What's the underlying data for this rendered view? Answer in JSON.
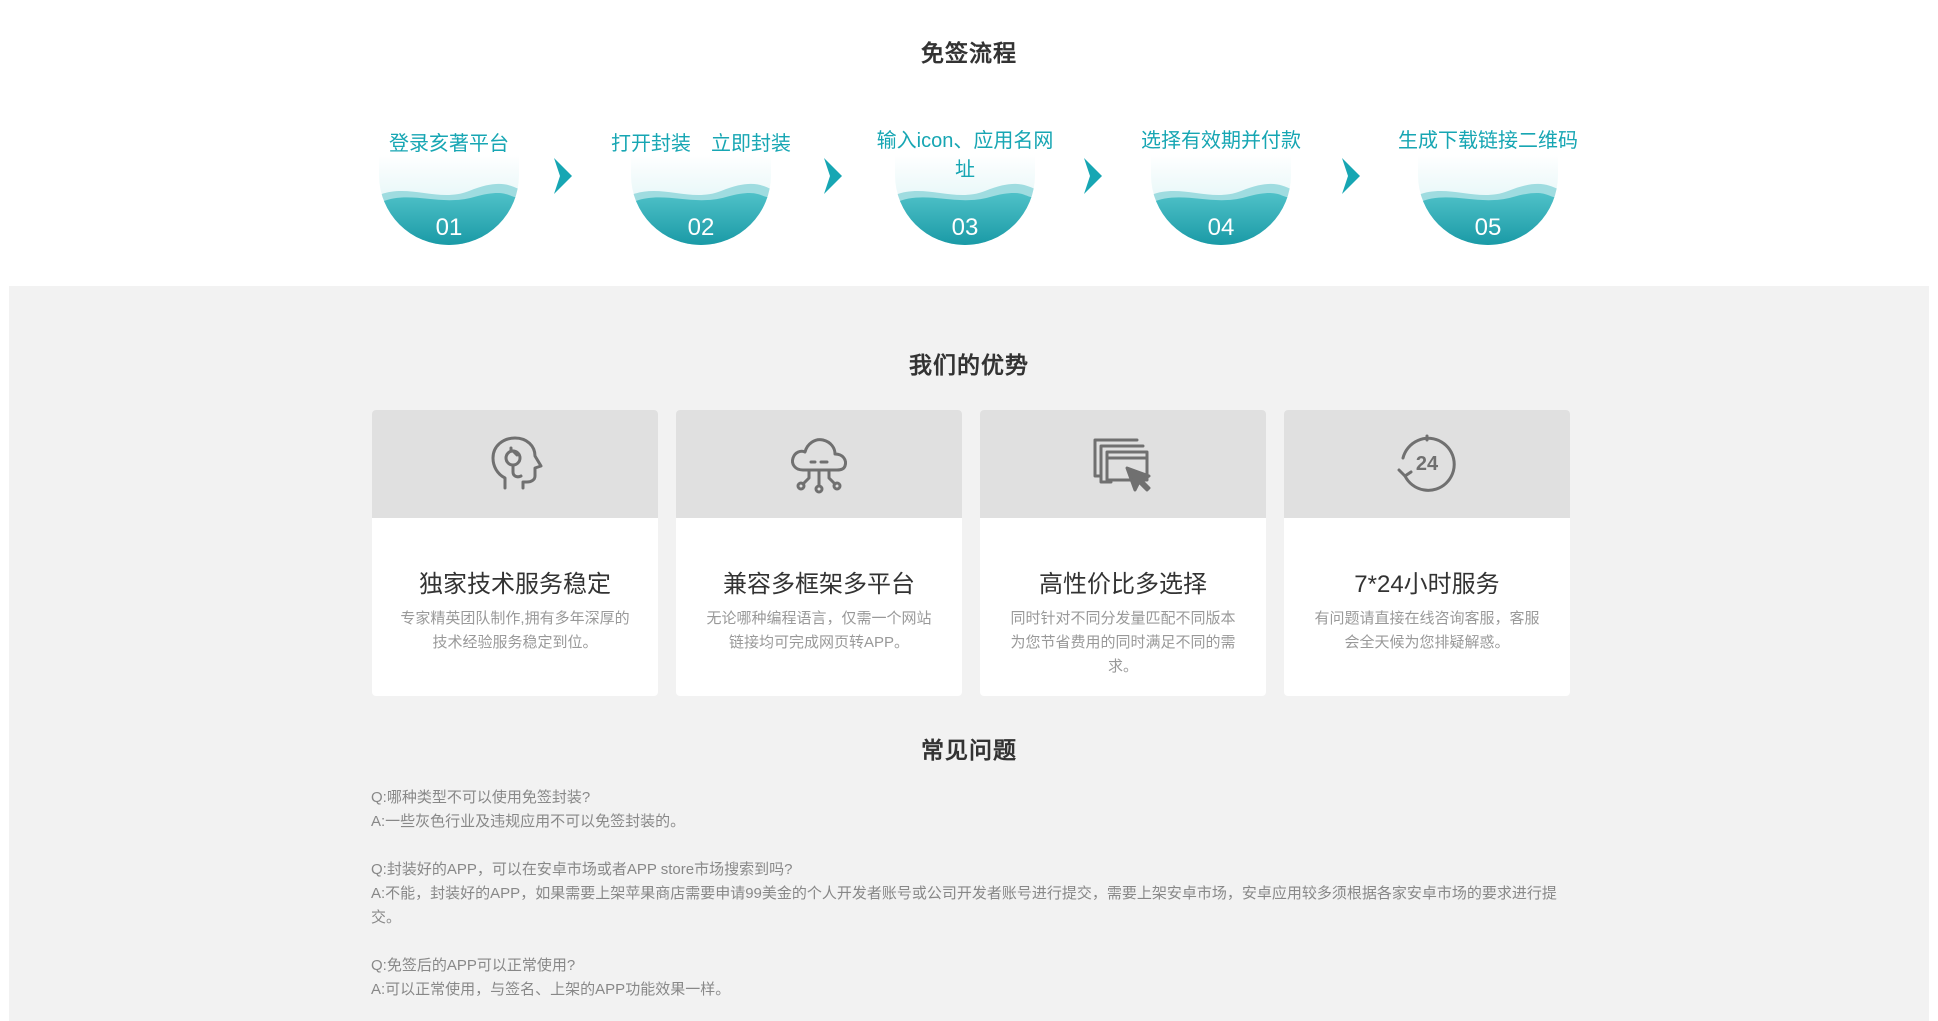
{
  "process": {
    "title": "免签流程",
    "steps": [
      {
        "label": "登录亥著平台",
        "num": "01"
      },
      {
        "label": "打开封装　立即封装",
        "num": "02"
      },
      {
        "label": "输入icon、应用名网址",
        "num": "03"
      },
      {
        "label": "选择有效期并付款",
        "num": "04"
      },
      {
        "label": "生成下载链接二维码",
        "num": "05"
      }
    ],
    "accent": "#17a6b3"
  },
  "advantages": {
    "title": "我们的优势",
    "cards": [
      {
        "icon": "tech-head-icon",
        "title": "独家技术服务稳定",
        "desc": "专家精英团队制作,拥有多年深厚的技术经验服务稳定到位。"
      },
      {
        "icon": "cloud-network-icon",
        "title": "兼容多框架多平台",
        "desc": "无论哪种编程语言，仅需一个网站链接均可完成网页转APP。"
      },
      {
        "icon": "window-cursor-icon",
        "title": "高性价比多选择",
        "desc": "同时针对不同分发量匹配不同版本为您节省费用的同时满足不同的需求。"
      },
      {
        "icon": "clock-24-icon",
        "title": "7*24小时服务",
        "desc": "有问题请直接在线咨询客服，客服会全天候为您排疑解惑。"
      }
    ]
  },
  "faq": {
    "title": "常见问题",
    "items": [
      {
        "q": "Q:哪种类型不可以使用免签封装?",
        "a": "A:一些灰色行业及违规应用不可以免签封装的。"
      },
      {
        "q": "Q:封装好的APP，可以在安卓市场或者APP store市场搜索到吗?",
        "a": "A:不能，封装好的APP，如果需要上架苹果商店需要申请99美金的个人开发者账号或公司开发者账号进行提交，需要上架安卓市场，安卓应用较多须根据各家安卓市场的要求进行提交。"
      },
      {
        "q": "Q:免签后的APP可以正常使用?",
        "a": "A:可以正常使用，与签名、上架的APP功能效果一样。"
      }
    ]
  }
}
